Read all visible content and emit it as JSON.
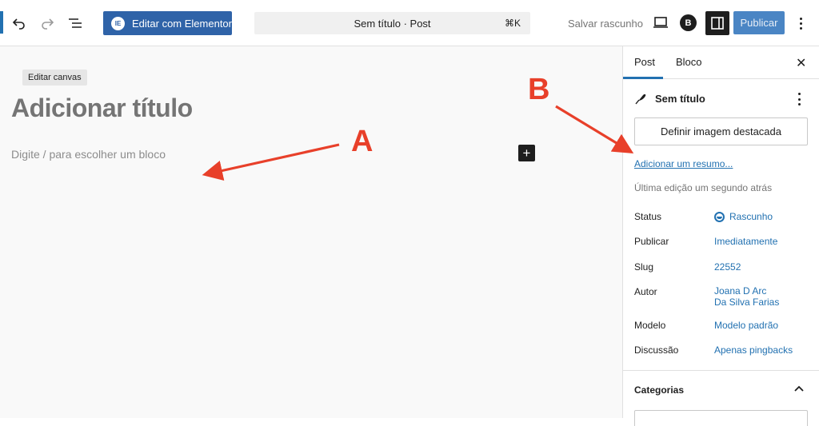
{
  "toolbar": {
    "undo_icon": "undo-icon",
    "redo_icon": "redo-icon",
    "list_view_icon": "list-view-icon",
    "elementor_badge": "IE",
    "elementor_label": "Editar com Elementor",
    "command_bar_label": "Sem título · Post",
    "command_shortcut": "⌘K",
    "save_draft_label": "Salvar rascunho",
    "preview_icon": "laptop-icon",
    "plugin_badge": "B",
    "settings_icon": "sidebar-toggle-icon",
    "publish_label": "Publicar",
    "options_icon": "more-vertical-icon"
  },
  "canvas": {
    "tooltip": "Editar canvas",
    "title_placeholder": "Adicionar título",
    "block_placeholder": "Digite / para escolher um bloco",
    "add_block_symbol": "+"
  },
  "sidebar": {
    "tabs": [
      {
        "label": "Post",
        "active": true
      },
      {
        "label": "Bloco",
        "active": false
      }
    ],
    "close_symbol": "✕",
    "post_title": "Sem título",
    "featured_image_label": "Definir imagem destacada",
    "excerpt_link": "Adicionar um resumo...",
    "last_edit": "Última edição um segundo atrás",
    "rows": [
      {
        "label": "Status",
        "value": "Rascunho"
      },
      {
        "label": "Publicar",
        "value": "Imediatamente"
      },
      {
        "label": "Slug",
        "value": "22552"
      },
      {
        "label": "Autor",
        "value": "Joana D Arc",
        "value2": "Da Silva Farias"
      },
      {
        "label": "Modelo",
        "value": "Modelo padrão"
      },
      {
        "label": "Discussão",
        "value": "Apenas pingbacks"
      }
    ],
    "categories_title": "Categorias"
  },
  "annotations": {
    "a_label": "A",
    "b_label": "B"
  },
  "colors": {
    "accent": "#2271b1",
    "elementor": "#2f63a8",
    "annotation": "#e8402a"
  }
}
